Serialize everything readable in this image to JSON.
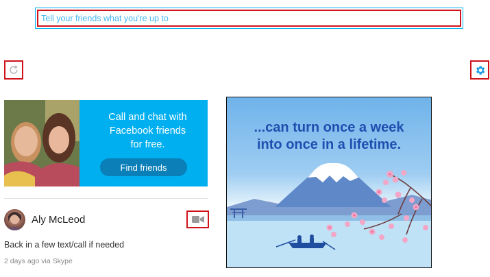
{
  "status": {
    "placeholder": "Tell your friends what you're up to"
  },
  "icons": {
    "refresh": "refresh-icon",
    "settings": "gear-icon",
    "video": "video-camera-icon"
  },
  "promo": {
    "lines": [
      "Call and chat with",
      "Facebook friends",
      "for free."
    ],
    "button_label": "Find friends"
  },
  "contact": {
    "name": "Aly McLeod",
    "mood": "Back in a few text/call if needed",
    "meta": "2 days ago via Skype"
  },
  "ad": {
    "headline_line1": "...can turn once a week",
    "headline_line2": "into once in a lifetime."
  },
  "colors": {
    "accent": "#00aff0",
    "highlight": "#d0131b",
    "ad_headline": "#1e4fb0"
  }
}
